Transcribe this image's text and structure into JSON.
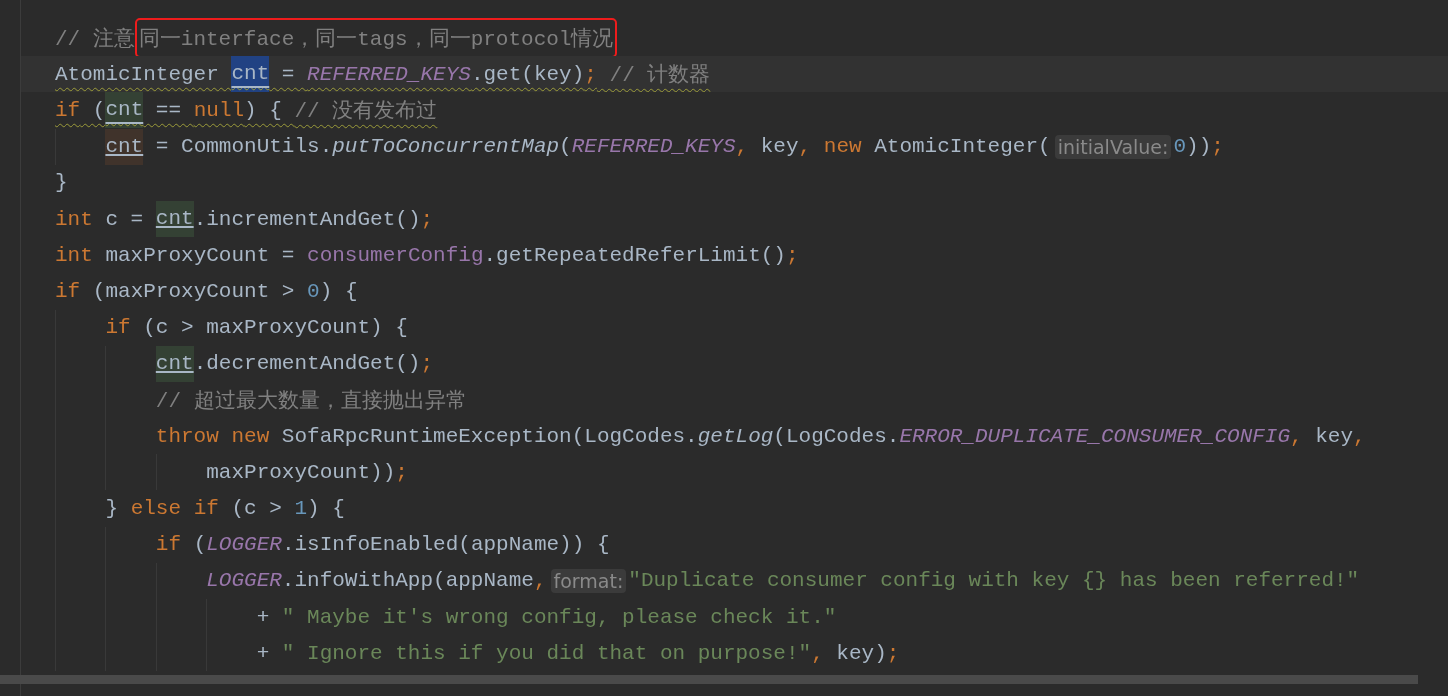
{
  "editor": {
    "lines": [
      {
        "tokens": [
          {
            "kind": "comment",
            "text": "// 注意"
          },
          {
            "kind": "comment",
            "text": "同一interface，同一tags，同一protocol情况",
            "boxed": true
          }
        ]
      },
      {
        "current": true,
        "warning": true,
        "tokens": [
          {
            "kind": "plain",
            "text": "AtomicInteger "
          },
          {
            "kind": "selected_usage",
            "text": "cnt"
          },
          {
            "kind": "plain",
            "text": " = "
          },
          {
            "kind": "field",
            "text": "REFERRED_KEYS"
          },
          {
            "kind": "plain",
            "text": ".get(key)"
          },
          {
            "kind": "punct",
            "text": ";"
          },
          {
            "kind": "comment",
            "text": " // 计数器"
          }
        ]
      },
      {
        "warning": true,
        "tokens": [
          {
            "kind": "keyword",
            "text": "if"
          },
          {
            "kind": "plain",
            "text": " ("
          },
          {
            "kind": "read_usage",
            "text": "cnt"
          },
          {
            "kind": "plain",
            "text": " == "
          },
          {
            "kind": "keyword",
            "text": "null"
          },
          {
            "kind": "plain",
            "text": ") { "
          },
          {
            "kind": "comment",
            "text": "// 没有发布过"
          }
        ],
        "children": [
          {
            "tokens": [
              {
                "kind": "write_usage",
                "text": "cnt"
              },
              {
                "kind": "plain",
                "text": " = CommonUtils."
              },
              {
                "kind": "static_method",
                "text": "putToConcurrentMap"
              },
              {
                "kind": "plain",
                "text": "("
              },
              {
                "kind": "field",
                "text": "REFERRED_KEYS"
              },
              {
                "kind": "punct",
                "text": ","
              },
              {
                "kind": "plain",
                "text": " key"
              },
              {
                "kind": "punct",
                "text": ","
              },
              {
                "kind": "keyword",
                "text": " new"
              },
              {
                "kind": "plain",
                "text": " AtomicInteger("
              },
              {
                "kind": "hint",
                "text": "initialValue:"
              },
              {
                "kind": "number",
                "text": "0"
              },
              {
                "kind": "plain",
                "text": "))"
              },
              {
                "kind": "punct",
                "text": ";"
              }
            ]
          }
        ]
      },
      {
        "tokens": [
          {
            "kind": "plain",
            "text": "}"
          }
        ]
      },
      {
        "tokens": [
          {
            "kind": "keyword",
            "text": "int"
          },
          {
            "kind": "plain",
            "text": " c = "
          },
          {
            "kind": "read_usage",
            "text": "cnt"
          },
          {
            "kind": "plain",
            "text": ".incrementAndGet()"
          },
          {
            "kind": "punct",
            "text": ";"
          }
        ]
      },
      {
        "tokens": [
          {
            "kind": "keyword",
            "text": "int"
          },
          {
            "kind": "plain",
            "text": " maxProxyCount = "
          },
          {
            "kind": "member",
            "text": "consumerConfig"
          },
          {
            "kind": "plain",
            "text": ".getRepeatedReferLimit()"
          },
          {
            "kind": "punct",
            "text": ";"
          }
        ]
      },
      {
        "tokens": [
          {
            "kind": "keyword",
            "text": "if"
          },
          {
            "kind": "plain",
            "text": " (maxProxyCount > "
          },
          {
            "kind": "number",
            "text": "0"
          },
          {
            "kind": "plain",
            "text": ") {"
          }
        ],
        "children": [
          {
            "tokens": [
              {
                "kind": "keyword",
                "text": "if"
              },
              {
                "kind": "plain",
                "text": " (c > maxProxyCount) {"
              }
            ],
            "children": [
              {
                "tokens": [
                  {
                    "kind": "read_usage",
                    "text": "cnt"
                  },
                  {
                    "kind": "plain",
                    "text": ".decrementAndGet()"
                  },
                  {
                    "kind": "punct",
                    "text": ";"
                  }
                ]
              },
              {
                "tokens": [
                  {
                    "kind": "comment",
                    "text": "// 超过最大数量，直接抛出异常"
                  }
                ]
              },
              {
                "tokens": [
                  {
                    "kind": "keyword",
                    "text": "throw new"
                  },
                  {
                    "kind": "plain",
                    "text": " SofaRpcRuntimeException(LogCodes."
                  },
                  {
                    "kind": "static_method",
                    "text": "getLog"
                  },
                  {
                    "kind": "plain",
                    "text": "(LogCodes."
                  },
                  {
                    "kind": "field",
                    "text": "ERROR_DUPLICATE_CONSUMER_CONFIG"
                  },
                  {
                    "kind": "punct",
                    "text": ","
                  },
                  {
                    "kind": "plain",
                    "text": " key"
                  },
                  {
                    "kind": "punct",
                    "text": ","
                  }
                ],
                "children": [
                  {
                    "tokens": [
                      {
                        "kind": "plain",
                        "text": "maxProxyCount))"
                      },
                      {
                        "kind": "punct",
                        "text": ";"
                      }
                    ]
                  }
                ]
              }
            ]
          },
          {
            "tokens": [
              {
                "kind": "plain",
                "text": "} "
              },
              {
                "kind": "keyword",
                "text": "else if"
              },
              {
                "kind": "plain",
                "text": " (c > "
              },
              {
                "kind": "number",
                "text": "1"
              },
              {
                "kind": "plain",
                "text": ") {"
              }
            ],
            "children": [
              {
                "tokens": [
                  {
                    "kind": "keyword",
                    "text": "if"
                  },
                  {
                    "kind": "plain",
                    "text": " ("
                  },
                  {
                    "kind": "field",
                    "text": "LOGGER"
                  },
                  {
                    "kind": "plain",
                    "text": ".isInfoEnabled(appName)) {"
                  }
                ],
                "children": [
                  {
                    "tokens": [
                      {
                        "kind": "field",
                        "text": "LOGGER"
                      },
                      {
                        "kind": "plain",
                        "text": ".infoWithApp(appName"
                      },
                      {
                        "kind": "punct",
                        "text": ","
                      },
                      {
                        "kind": "hint",
                        "text": "format:"
                      },
                      {
                        "kind": "string",
                        "text": "\"Duplicate consumer config with key {} has been referred!\""
                      }
                    ],
                    "children": [
                      {
                        "tokens": [
                          {
                            "kind": "plain",
                            "text": "+ "
                          },
                          {
                            "kind": "string",
                            "text": "\" Maybe it's wrong config, please check it.\""
                          }
                        ]
                      },
                      {
                        "tokens": [
                          {
                            "kind": "plain",
                            "text": "+ "
                          },
                          {
                            "kind": "string",
                            "text": "\" Ignore this if you did that on purpose!\""
                          },
                          {
                            "kind": "punct",
                            "text": ","
                          },
                          {
                            "kind": "plain",
                            "text": " key)"
                          },
                          {
                            "kind": "punct",
                            "text": ";"
                          }
                        ]
                      }
                    ]
                  }
                ]
              }
            ]
          }
        ]
      }
    ]
  }
}
